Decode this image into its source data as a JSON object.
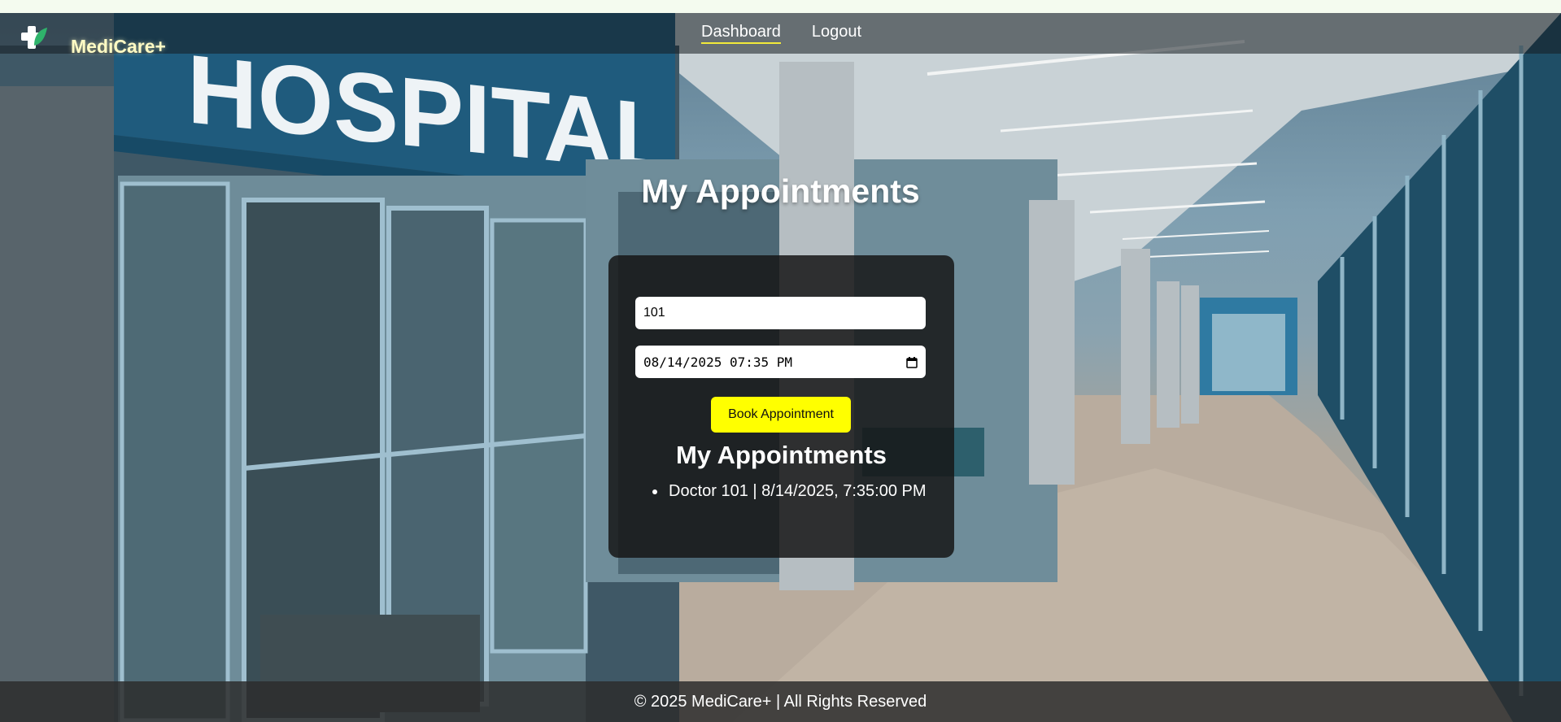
{
  "brand": {
    "name": "MediCare+",
    "icon": "medical-cross-leaf-icon"
  },
  "nav": {
    "links": [
      {
        "label": "Dashboard",
        "active": true
      },
      {
        "label": "Logout",
        "active": false
      }
    ]
  },
  "background": {
    "sign_text": "HOSPITAL"
  },
  "main": {
    "title": "My Appointments"
  },
  "form": {
    "doctor_id_value": "101",
    "datetime_value": "08/14/2025 07:35 PM",
    "book_button_label": "Book Appointment"
  },
  "appointments": {
    "title": "My Appointments",
    "items": [
      {
        "text": "Doctor 101 | 8/14/2025, 7:35:00 PM"
      }
    ]
  },
  "footer": {
    "text": "© 2025 MediCare+ | All Rights Reserved"
  },
  "colors": {
    "accent_yellow": "#ffff00",
    "brand_text": "#fffbc4",
    "card_bg": "#161616",
    "nav_underline": "#f2ea3a"
  }
}
